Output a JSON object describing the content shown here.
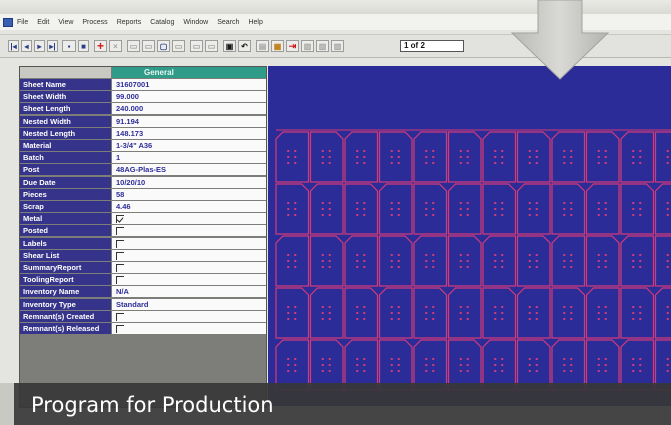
{
  "menu": [
    "File",
    "Edit",
    "View",
    "Process",
    "Reports",
    "Catalog",
    "Window",
    "Search",
    "Help"
  ],
  "toolbar": {
    "page_indicator": "1 of 2"
  },
  "grid": {
    "header": "General",
    "rows": [
      {
        "label": "Sheet Name",
        "value": "31607001"
      },
      {
        "label": "Sheet Width",
        "value": "99.000"
      },
      {
        "label": "Sheet Length",
        "value": "240.000"
      },
      {
        "label": "Nested Width",
        "value": "91.194"
      },
      {
        "label": "Nested Length",
        "value": "148.173"
      },
      {
        "label": "Material",
        "value": "1-3/4\"    A36"
      },
      {
        "label": "Batch",
        "value": "1"
      },
      {
        "label": "Post",
        "value": "48AG-Plas-ES"
      },
      {
        "label": "Due Date",
        "value": "10/20/10"
      },
      {
        "label": "Pieces",
        "value": "58"
      },
      {
        "label": "Scrap",
        "value": "4.46"
      },
      {
        "label": "Metal",
        "value": "",
        "checked": true
      },
      {
        "label": "Posted",
        "value": "",
        "checked": false
      },
      {
        "label": "Labels",
        "value": "",
        "checked": false
      },
      {
        "label": "Shear List",
        "value": "",
        "checked": false
      },
      {
        "label": "SummaryReport",
        "value": "",
        "checked": false
      },
      {
        "label": "ToolingReport",
        "value": "",
        "checked": false
      },
      {
        "label": "Inventory Name",
        "value": "N/A"
      },
      {
        "label": "Inventory Type",
        "value": "Standard"
      },
      {
        "label": "Remnant(s) Created",
        "value": "",
        "checked": false
      },
      {
        "label": "Remnant(s) Released",
        "value": "",
        "checked": false
      }
    ]
  },
  "caption": "Program for Production",
  "colors": {
    "nest_bg": "#2c2c98",
    "part_line": "#d23a78",
    "label_bg": "#36348a",
    "value_text": "#2d2d9a",
    "header_bg": "#2e9c88",
    "caption_bg": "#373737"
  }
}
